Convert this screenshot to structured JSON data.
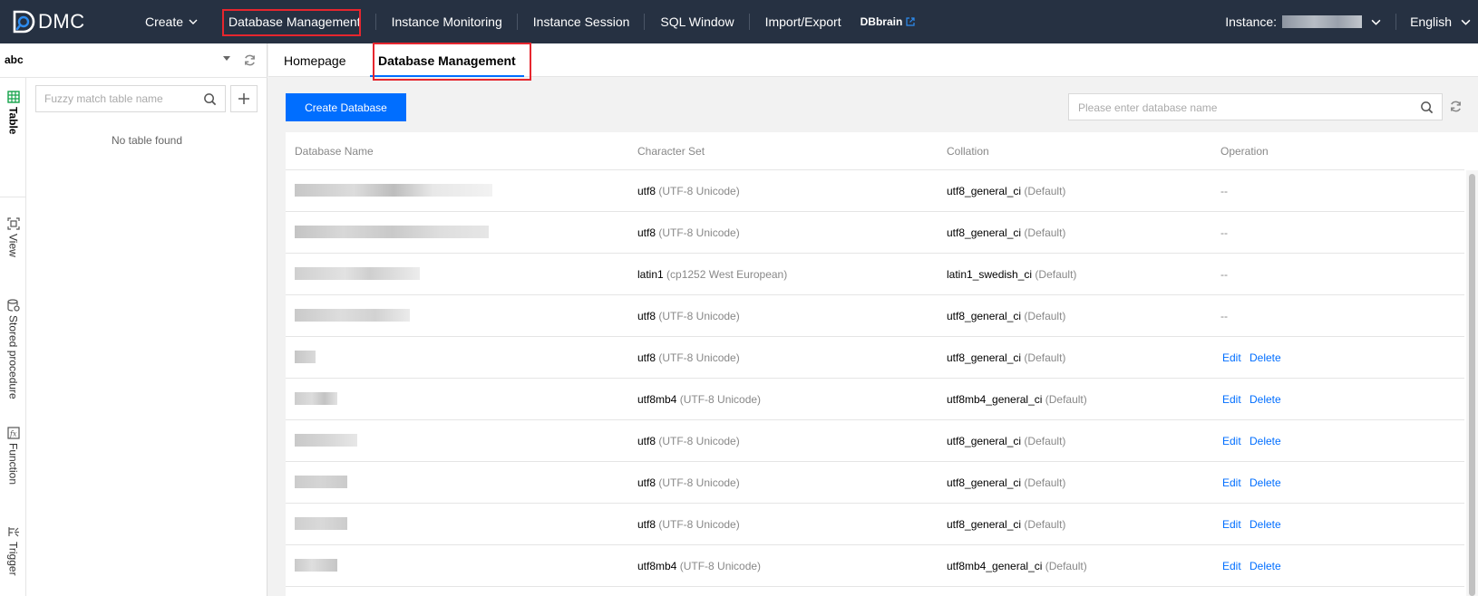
{
  "app": {
    "logo_text": "DMC"
  },
  "nav": {
    "create": "Create",
    "database_management": "Database Management",
    "instance_monitoring": "Instance Monitoring",
    "instance_session": "Instance Session",
    "sql_window": "SQL Window",
    "import_export": "Import/Export",
    "dbbrain": "DBbrain"
  },
  "header_right": {
    "instance_label": "Instance:",
    "language": "English"
  },
  "left": {
    "database": "abc",
    "table_search_placeholder": "Fuzzy match table name",
    "empty_message": "No table found",
    "side_tabs": [
      "Table",
      "View",
      "Stored procedure",
      "Function",
      "Trigger"
    ]
  },
  "main": {
    "tabs": [
      "Homepage",
      "Database Management"
    ],
    "create_button": "Create Database",
    "search_placeholder": "Please enter database name",
    "columns": [
      "Database Name",
      "Character Set",
      "Collation",
      "Operation"
    ],
    "rows": [
      {
        "charset": "utf8",
        "charset_desc": "(UTF-8 Unicode)",
        "collation": "utf8_general_ci",
        "collation_note": "(Default)",
        "op": "--"
      },
      {
        "charset": "utf8",
        "charset_desc": "(UTF-8 Unicode)",
        "collation": "utf8_general_ci",
        "collation_note": "(Default)",
        "op": "--"
      },
      {
        "charset": "latin1",
        "charset_desc": "(cp1252 West European)",
        "collation": "latin1_swedish_ci",
        "collation_note": "(Default)",
        "op": "--"
      },
      {
        "charset": "utf8",
        "charset_desc": "(UTF-8 Unicode)",
        "collation": "utf8_general_ci",
        "collation_note": "(Default)",
        "op": "--"
      },
      {
        "charset": "utf8",
        "charset_desc": "(UTF-8 Unicode)",
        "collation": "utf8_general_ci",
        "collation_note": "(Default)",
        "edit": "Edit",
        "delete": "Delete"
      },
      {
        "charset": "utf8mb4",
        "charset_desc": "(UTF-8 Unicode)",
        "collation": "utf8mb4_general_ci",
        "collation_note": "(Default)",
        "edit": "Edit",
        "delete": "Delete"
      },
      {
        "charset": "utf8",
        "charset_desc": "(UTF-8 Unicode)",
        "collation": "utf8_general_ci",
        "collation_note": "(Default)",
        "edit": "Edit",
        "delete": "Delete"
      },
      {
        "charset": "utf8",
        "charset_desc": "(UTF-8 Unicode)",
        "collation": "utf8_general_ci",
        "collation_note": "(Default)",
        "edit": "Edit",
        "delete": "Delete"
      },
      {
        "charset": "utf8",
        "charset_desc": "(UTF-8 Unicode)",
        "collation": "utf8_general_ci",
        "collation_note": "(Default)",
        "edit": "Edit",
        "delete": "Delete"
      },
      {
        "charset": "utf8mb4",
        "charset_desc": "(UTF-8 Unicode)",
        "collation": "utf8mb4_general_ci",
        "collation_note": "(Default)",
        "edit": "Edit",
        "delete": "Delete"
      }
    ]
  },
  "colors": {
    "topbar": "#263142",
    "primary": "#006eff",
    "highlight": "#e6262e"
  }
}
